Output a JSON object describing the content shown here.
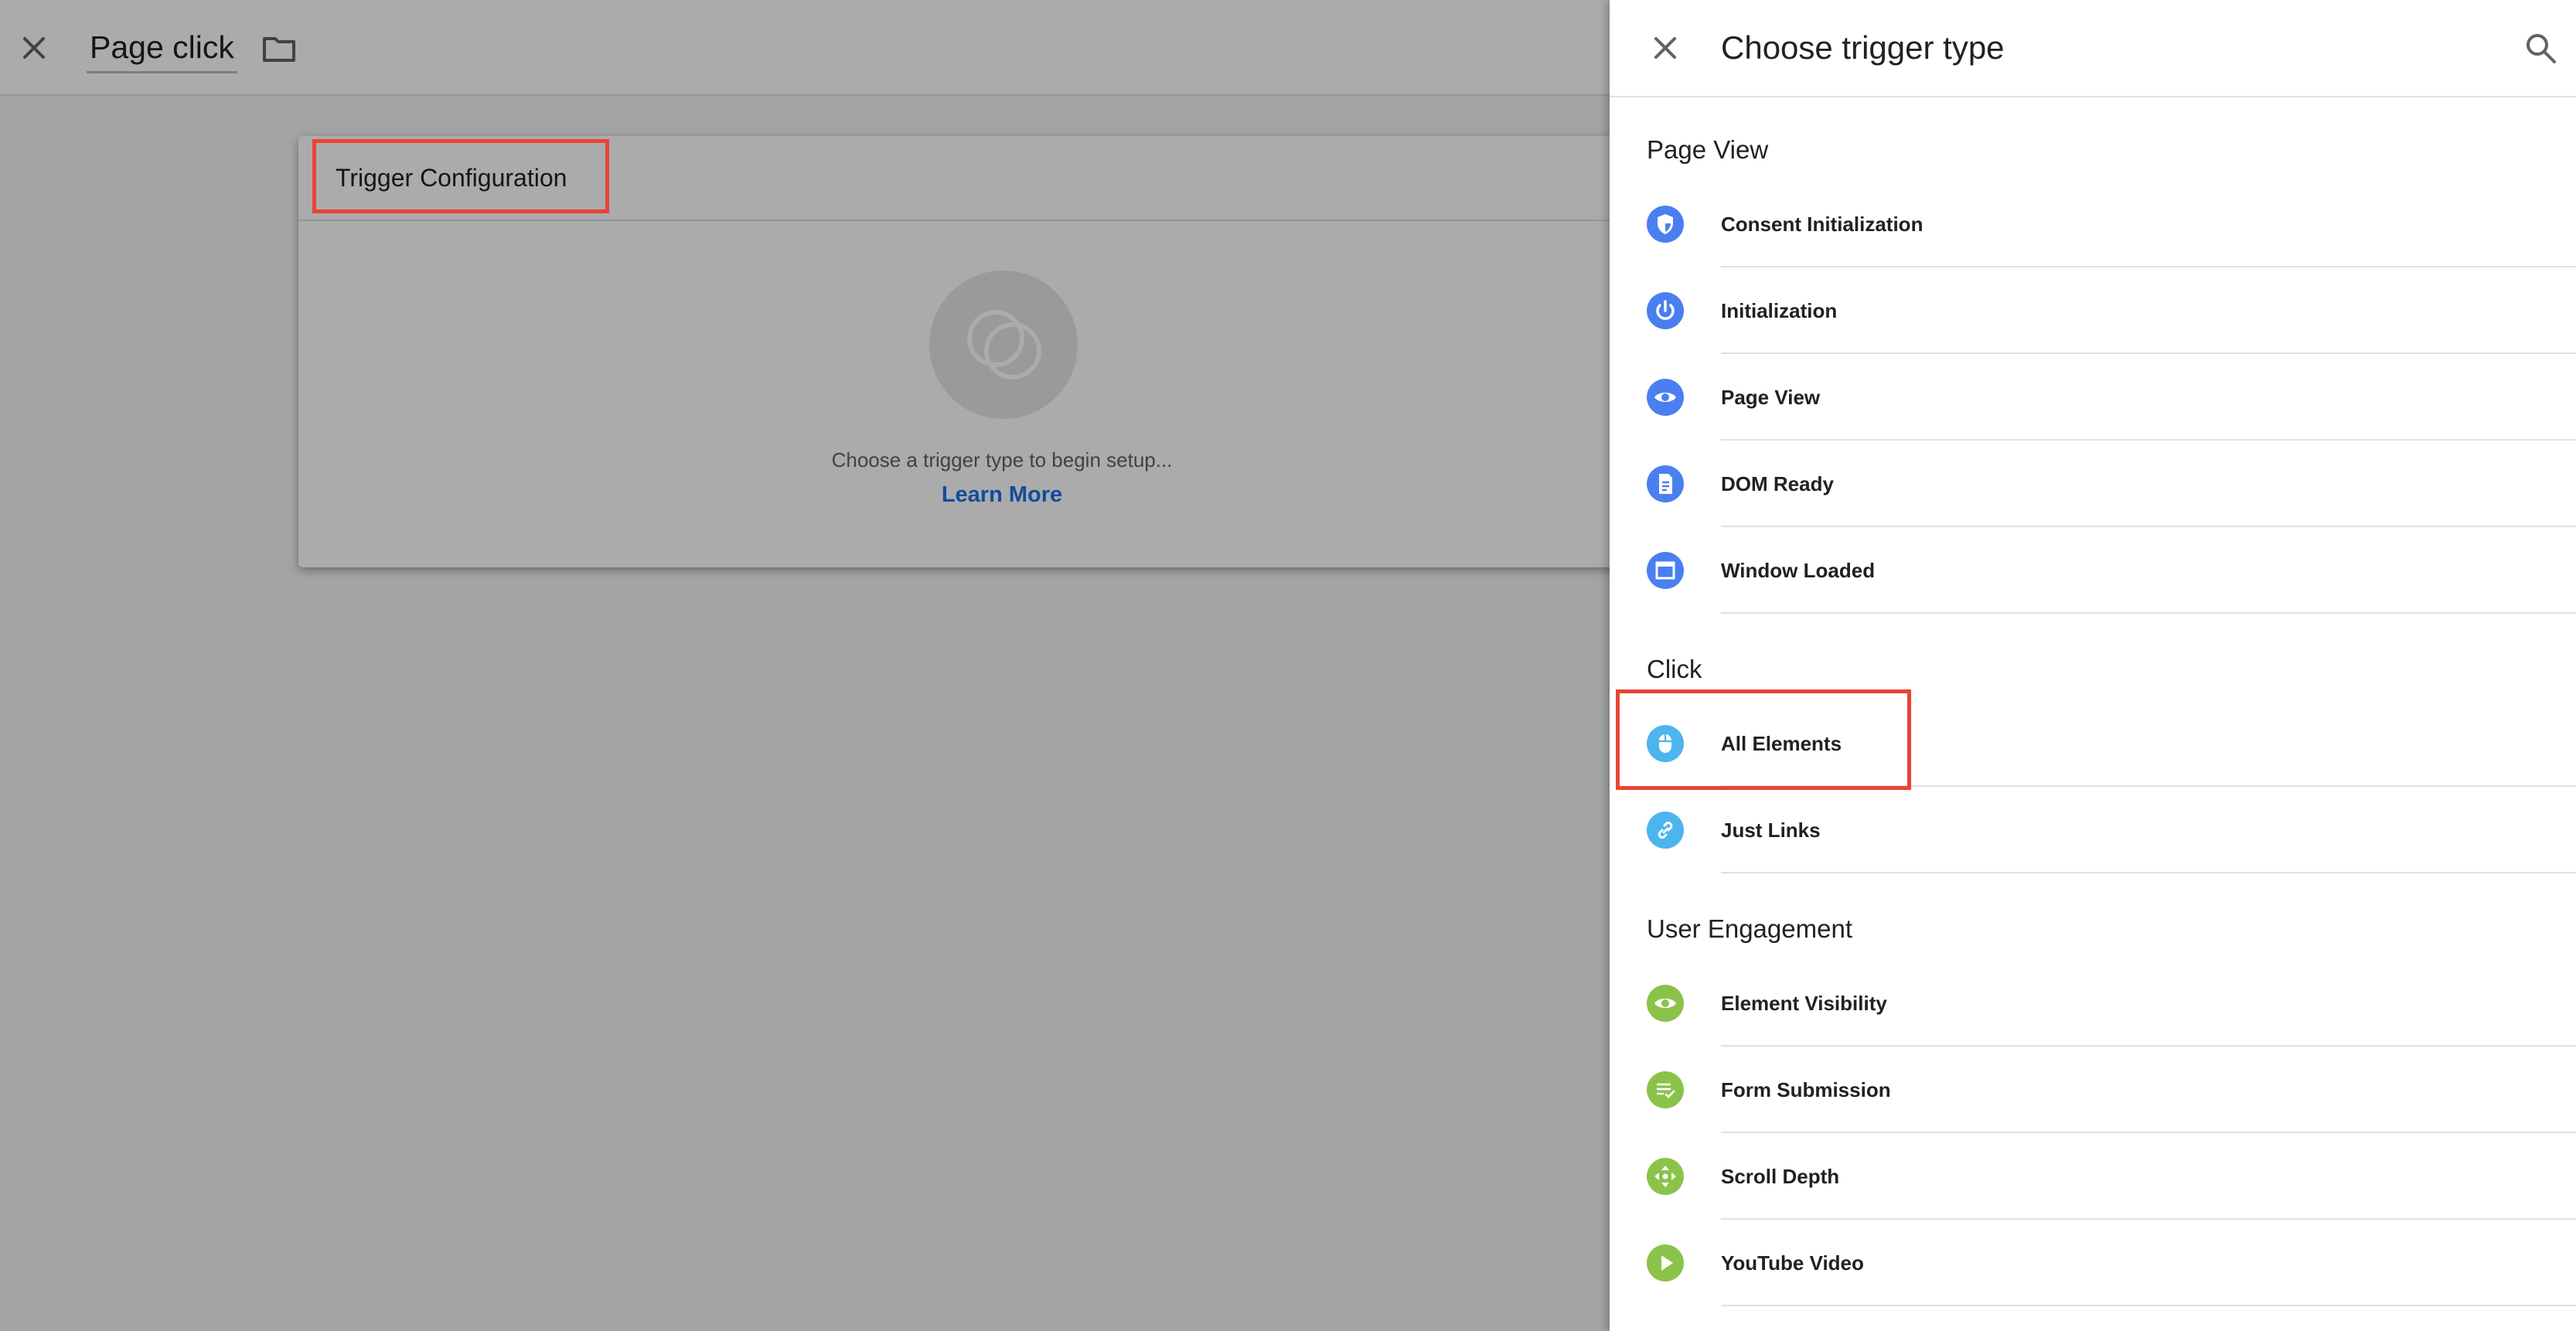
{
  "editor": {
    "tag_name": "Page click",
    "card": {
      "title": "Trigger Configuration",
      "hint": "Choose a trigger type to begin setup...",
      "learn_more": "Learn More"
    }
  },
  "panel": {
    "title": "Choose trigger type",
    "sections": [
      {
        "title": "Page View",
        "items": [
          {
            "label": "Consent Initialization",
            "icon": "shield-icon",
            "color": "#4a7ff0"
          },
          {
            "label": "Initialization",
            "icon": "power-icon",
            "color": "#4a7ff0"
          },
          {
            "label": "Page View",
            "icon": "eye-icon",
            "color": "#4a7ff0"
          },
          {
            "label": "DOM Ready",
            "icon": "document-icon",
            "color": "#4a7ff0"
          },
          {
            "label": "Window Loaded",
            "icon": "window-icon",
            "color": "#4a7ff0"
          }
        ]
      },
      {
        "title": "Click",
        "items": [
          {
            "label": "All Elements",
            "icon": "mouse-icon",
            "color": "#4db5ee"
          },
          {
            "label": "Just Links",
            "icon": "link-icon",
            "color": "#4db5ee"
          }
        ]
      },
      {
        "title": "User Engagement",
        "items": [
          {
            "label": "Element Visibility",
            "icon": "eye-icon",
            "color": "#8bc34a"
          },
          {
            "label": "Form Submission",
            "icon": "form-check-icon",
            "color": "#8bc34a"
          },
          {
            "label": "Scroll Depth",
            "icon": "scroll-arrows-icon",
            "color": "#8bc34a"
          },
          {
            "label": "YouTube Video",
            "icon": "play-icon",
            "color": "#8bc34a"
          }
        ]
      }
    ]
  },
  "highlight_color": "#ea4335"
}
